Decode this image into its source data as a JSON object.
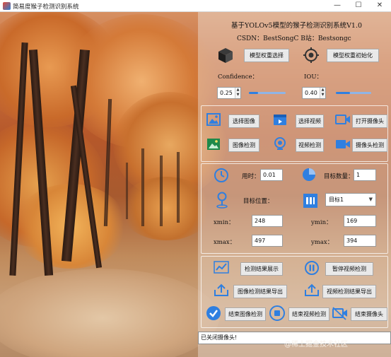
{
  "window": {
    "title": "简易度猴子检测识别系统",
    "minimize_glyph": "—",
    "maximize_glyph": "☐",
    "close_glyph": "✕"
  },
  "header": {
    "title": "基于YOLOv5模型的猴子检测识别系统V1.0",
    "credits": "CSDN：BestSongC   B站：Bestsongc"
  },
  "model": {
    "select_weights_label": "模型权重选择",
    "init_weights_label": "模型权重初始化",
    "confidence_label": "Confidence：",
    "iou_label": "IOU：",
    "confidence_value": "0.25",
    "iou_value": "0.40",
    "confidence_level": 0.25,
    "iou_level": 0.4,
    "icons": [
      "cube-icon",
      "target-icon"
    ]
  },
  "media": {
    "select_image_label": "选择图像",
    "select_video_label": "选择视频",
    "open_camera_label": "打开摄像头",
    "image_detect_label": "图像检测",
    "video_detect_label": "视频检测",
    "camera_detect_label": "摄像头检测"
  },
  "results": {
    "time_label": "用时：",
    "time_value": "0.01",
    "count_label": "目标数量：",
    "count_value": "1",
    "position_label": "目标位置：",
    "target_select_value": "目标1",
    "xmin_label": "xmin：",
    "xmin_value": "248",
    "ymin_label": "ymin：",
    "ymin_value": "169",
    "xmax_label": "xmax：",
    "xmax_value": "497",
    "ymax_label": "ymax：",
    "ymax_value": "394"
  },
  "actions": {
    "show_results_label": "检测结果展示",
    "pause_video_label": "暂停视频检测",
    "export_image_label": "图像检测结果导出",
    "export_video_label": "视频检测结果导出",
    "end_image_label": "结束图像检测",
    "end_video_label": "结束视频检测",
    "end_camera_label": "结束摄像头"
  },
  "status": {
    "text": "已关闭摄像头!"
  },
  "watermark": "@稀土掘金技术社区",
  "colors": {
    "accent": "#2f7fe0",
    "button_bg": "#e9e9e9",
    "panel_veil": "#eee1d6"
  }
}
